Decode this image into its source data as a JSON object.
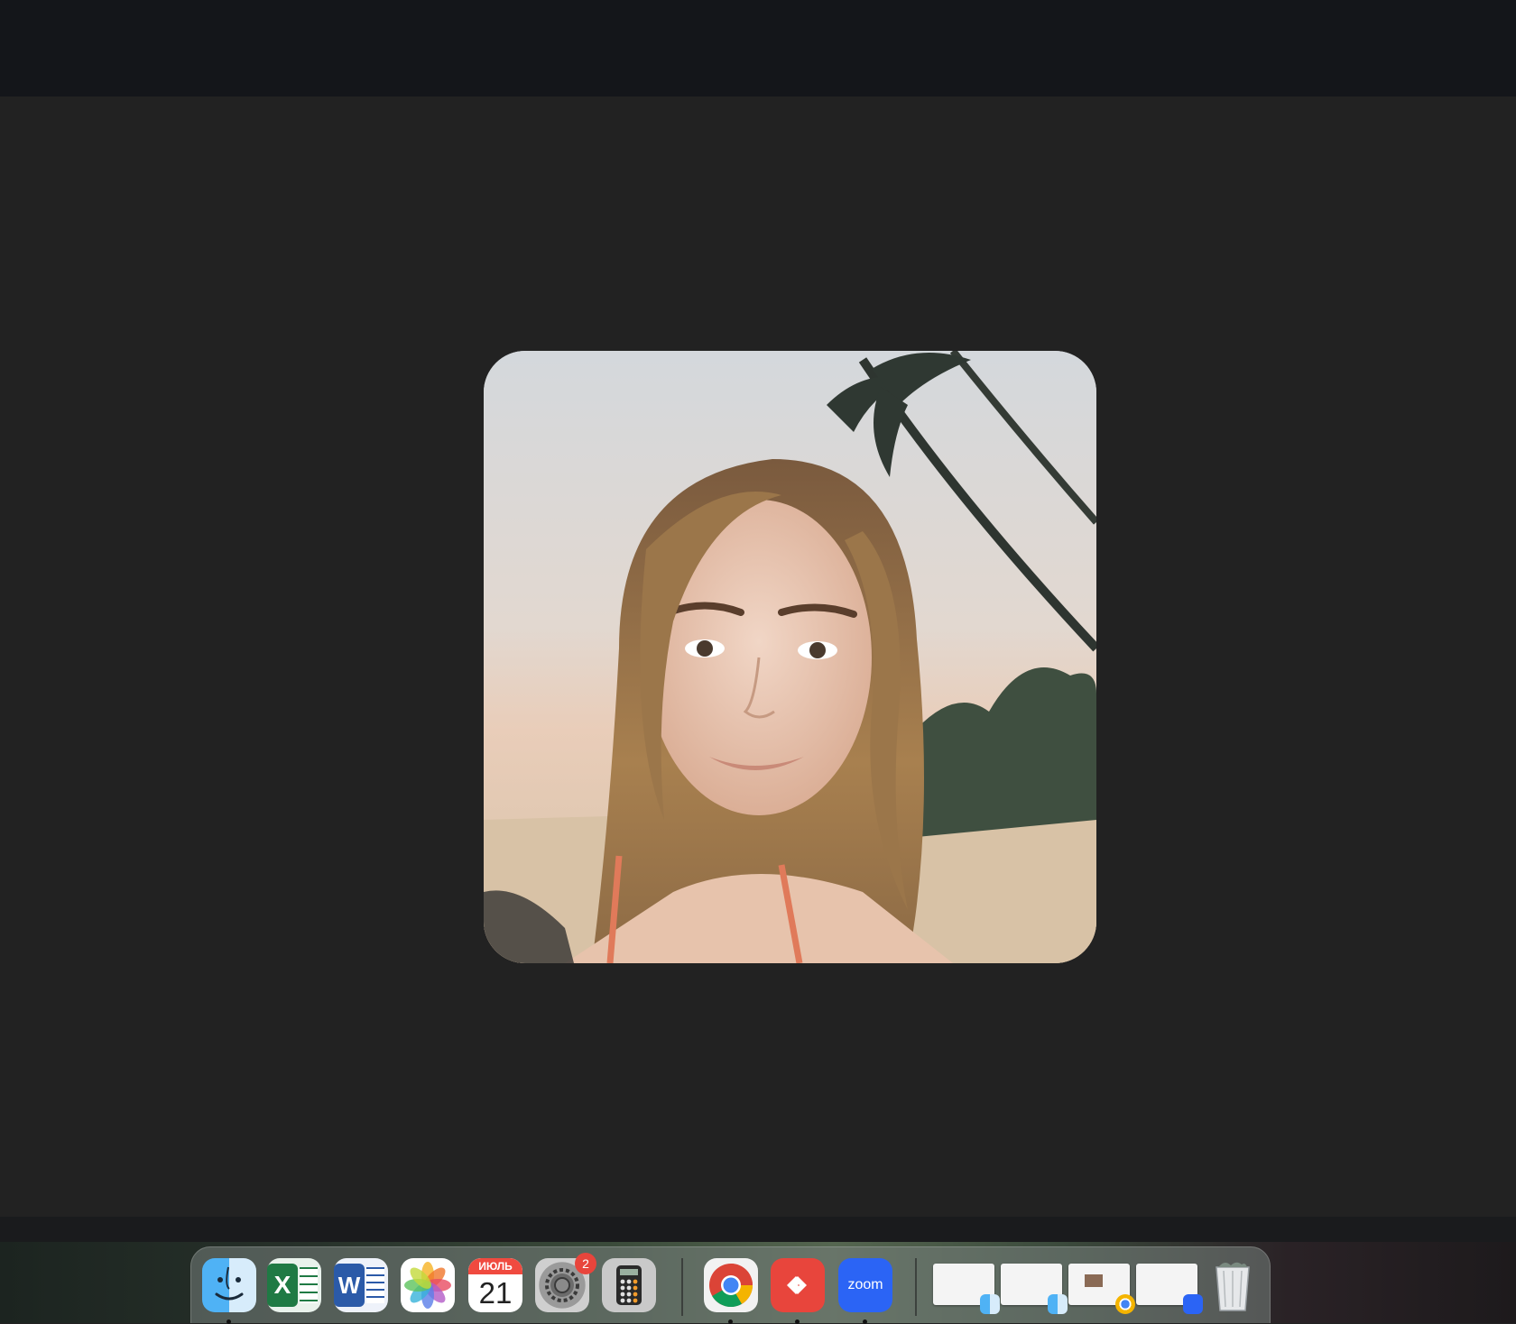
{
  "window": {
    "top_bar": "",
    "photo": {
      "subject": "portrait-photo"
    }
  },
  "dock": {
    "apps": [
      {
        "name": "Finder",
        "icon": "finder-icon",
        "running": true
      },
      {
        "name": "Microsoft Excel",
        "icon": "excel-icon",
        "running": false
      },
      {
        "name": "Microsoft Word",
        "icon": "word-icon",
        "running": false
      },
      {
        "name": "Photos",
        "icon": "photos-icon",
        "running": false
      },
      {
        "name": "Calendar",
        "icon": "calendar-icon",
        "running": false,
        "month": "ИЮЛЬ",
        "day": "21"
      },
      {
        "name": "System Settings",
        "icon": "settings-icon",
        "running": false,
        "badge": "2"
      },
      {
        "name": "Calculator",
        "icon": "calculator-icon",
        "running": false
      },
      {
        "name": "Google Chrome",
        "icon": "chrome-icon",
        "running": true
      },
      {
        "name": "AnyDesk",
        "icon": "anydesk-icon",
        "running": true
      },
      {
        "name": "Zoom",
        "icon": "zoom-icon",
        "running": true,
        "label": "zoom"
      }
    ],
    "minimized": [
      {
        "icon": "finder-window-thumbnail",
        "owner": "finder-icon"
      },
      {
        "icon": "finder-window-thumbnail",
        "owner": "finder-icon"
      },
      {
        "icon": "chrome-window-thumbnail",
        "owner": "chrome-icon"
      },
      {
        "icon": "zoom-window-thumbnail",
        "owner": "zoom-icon"
      }
    ],
    "trash": {
      "icon": "trash-icon"
    }
  },
  "colors": {
    "background": "#222222",
    "top_bar": "#14161a",
    "excel": "#1f7a44",
    "word": "#2b5aa8",
    "zoom": "#2b64f5",
    "anydesk": "#e8453c",
    "calendar_header": "#f04a3f",
    "badge": "#e8453c"
  }
}
